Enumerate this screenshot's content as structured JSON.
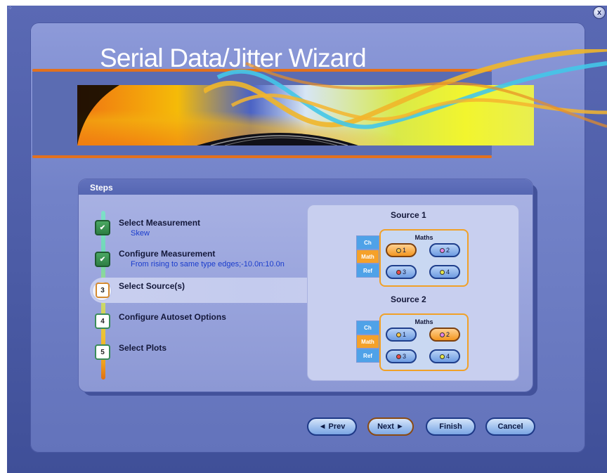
{
  "window": {
    "title": "Serial Data/Jitter Wizard",
    "close_label": "x"
  },
  "steps": {
    "header": "Steps",
    "items": [
      {
        "number": "",
        "title": "Select Measurement",
        "subtitle": "Skew",
        "state": "done"
      },
      {
        "number": "",
        "title": "Configure Measurement",
        "subtitle": "From rising to same type edges;-10.0n:10.0n",
        "state": "done"
      },
      {
        "number": "3",
        "title": "Select Source(s)",
        "subtitle": "",
        "state": "current"
      },
      {
        "number": "4",
        "title": "Configure Autoset Options",
        "subtitle": "",
        "state": "pending"
      },
      {
        "number": "5",
        "title": "Select Plots",
        "subtitle": "",
        "state": "pending"
      }
    ]
  },
  "sources": [
    {
      "title": "Source 1",
      "tabs": [
        "Ch",
        "Math",
        "Ref"
      ],
      "active_tab": "Math",
      "group_label": "Maths",
      "buttons": [
        {
          "label": "1",
          "dot_color": "#f5c74a",
          "selected": true
        },
        {
          "label": "2",
          "dot_color": "#e685e6",
          "selected": false
        },
        {
          "label": "3",
          "dot_color": "#e84a4a",
          "selected": false
        },
        {
          "label": "4",
          "dot_color": "#e6e64a",
          "selected": false
        }
      ]
    },
    {
      "title": "Source 2",
      "tabs": [
        "Ch",
        "Math",
        "Ref"
      ],
      "active_tab": "Math",
      "group_label": "Maths",
      "buttons": [
        {
          "label": "1",
          "dot_color": "#f5c74a",
          "selected": false
        },
        {
          "label": "2",
          "dot_color": "#e685e6",
          "selected": true
        },
        {
          "label": "3",
          "dot_color": "#e84a4a",
          "selected": false
        },
        {
          "label": "4",
          "dot_color": "#e6e64a",
          "selected": false
        }
      ]
    }
  ],
  "nav": {
    "prev_label": "◄ Prev",
    "next_label": "Next ►",
    "finish_label": "Finish",
    "cancel_label": "Cancel"
  },
  "colors": {
    "accent_orange": "#e3711d",
    "check_green": "#2e7e44",
    "subtitle_blue": "#1a3ccc"
  }
}
